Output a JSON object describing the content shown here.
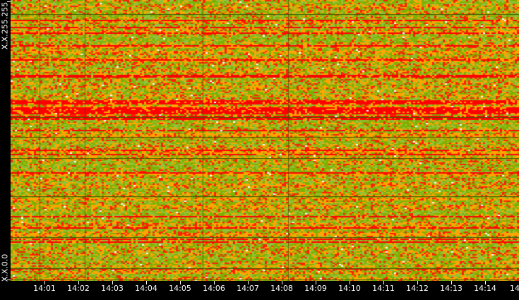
{
  "chart_data": {
    "type": "heatmap",
    "title": "",
    "xlabel": "",
    "ylabel": "",
    "x_tick_labels": [
      "14:01",
      "14:02",
      "14:03",
      "14:04",
      "14:05",
      "14:06",
      "14:07",
      "14:08",
      "14:09",
      "14:10",
      "14:11",
      "14:12",
      "14:13",
      "14:14",
      "14"
    ],
    "y_tick_labels": [
      "X.X.255.255",
      "X.X.0.0"
    ],
    "y_range": [
      "X.X.0.0",
      "X.X.255.255"
    ],
    "x_range": [
      "14:00",
      "14:15"
    ],
    "colorscale": [
      {
        "level": "low",
        "color": "#8fc23a"
      },
      {
        "level": "low-mid",
        "color": "#7fb000"
      },
      {
        "level": "mid",
        "color": "#ffa500"
      },
      {
        "level": "high",
        "color": "#ff2000"
      },
      {
        "level": "max",
        "color": "#ff0000"
      }
    ],
    "grid": false,
    "legend": "none"
  }
}
